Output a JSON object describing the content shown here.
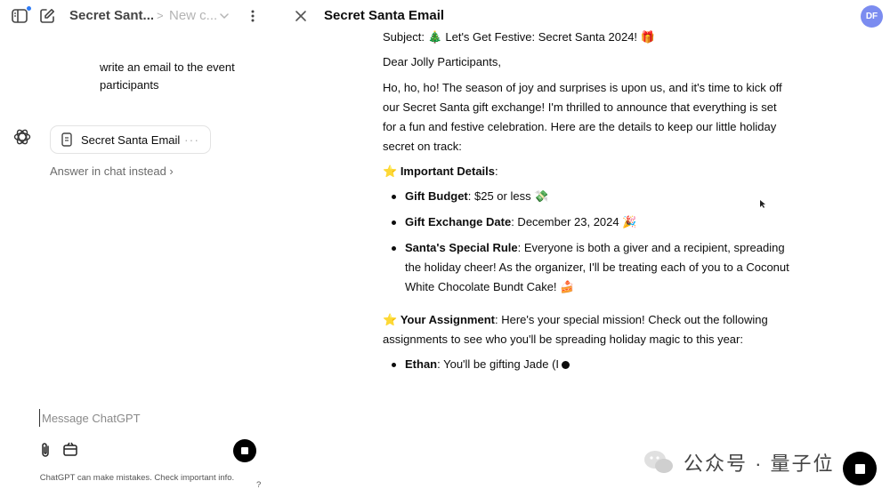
{
  "header": {
    "chat_title": "Secret Sant...",
    "breadcrumb_sep": ">",
    "breadcrumb_new": "New c...",
    "canvas_title": "Secret Santa Email",
    "avatar_initials": "DF"
  },
  "chat": {
    "user_message": "write an email to the event participants",
    "canvas_card_label": "Secret Santa Email",
    "card_more": "···",
    "answer_in_chat": "Answer in chat instead ›"
  },
  "composer": {
    "placeholder": "Message ChatGPT",
    "disclaimer": "ChatGPT can make mistakes. Check important info.",
    "help": "?"
  },
  "document": {
    "subject": "Subject: 🎄 Let's Get Festive: Secret Santa 2024! 🎁",
    "greeting": "Dear Jolly Participants,",
    "intro": "Ho, ho, ho! The season of joy and surprises is upon us, and it's time to kick off our Secret Santa gift exchange! I'm thrilled to announce that everything is set for a fun and festive celebration. Here are the details to keep our little holiday secret on track:",
    "details_star": "⭐ ",
    "details_heading": "Important Details",
    "details_colon": ":",
    "details": [
      {
        "label": "Gift Budget",
        "text": ": $25 or less 💸"
      },
      {
        "label": "Gift Exchange Date",
        "text": ": December 23, 2024 🎉"
      },
      {
        "label": "Santa's Special Rule",
        "text": ": Everyone is both a giver and a recipient, spreading the holiday cheer! As the organizer, I'll be treating each of you to a Coconut White Chocolate Bundt Cake! 🍰"
      }
    ],
    "assignment_star": "⭐ ",
    "assignment_heading": "Your Assignment",
    "assignment_text": ": Here's your special mission! Check out the following assignments to see who you'll be spreading holiday magic to this year:",
    "assignments": [
      {
        "label": "Ethan",
        "text": ": You'll be gifting Jade (I"
      }
    ]
  },
  "watermark": {
    "text": "公众号 · 量子位"
  },
  "colors": {
    "accent_dot": "#2f7cf6",
    "avatar_bg": "#7b8cf0",
    "stop_button": "#000000"
  }
}
